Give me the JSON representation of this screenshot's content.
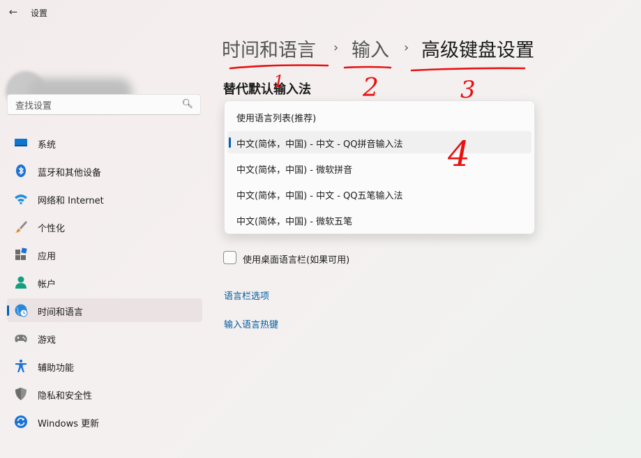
{
  "app": {
    "title": "设置"
  },
  "search": {
    "placeholder": "查找设置"
  },
  "sidebar": {
    "items": [
      {
        "label": "系统",
        "icon": "system-icon"
      },
      {
        "label": "蓝牙和其他设备",
        "icon": "bluetooth-icon"
      },
      {
        "label": "网络和 Internet",
        "icon": "wifi-icon"
      },
      {
        "label": "个性化",
        "icon": "brush-icon"
      },
      {
        "label": "应用",
        "icon": "apps-icon"
      },
      {
        "label": "帐户",
        "icon": "account-icon"
      },
      {
        "label": "时间和语言",
        "icon": "globe-clock-icon",
        "selected": true
      },
      {
        "label": "游戏",
        "icon": "gamepad-icon"
      },
      {
        "label": "辅助功能",
        "icon": "accessibility-icon"
      },
      {
        "label": "隐私和安全性",
        "icon": "shield-icon"
      },
      {
        "label": "Windows 更新",
        "icon": "update-icon"
      }
    ]
  },
  "breadcrumb": {
    "items": [
      "时间和语言",
      "输入",
      "高级键盘设置"
    ],
    "separator": "›"
  },
  "main": {
    "section_title": "替代默认输入法",
    "dropdown_options": [
      "使用语言列表(推荐)",
      "中文(简体，中国) - 中文 - QQ拼音输入法",
      "中文(简体，中国) - 微软拼音",
      "中文(简体，中国) - 中文 - QQ五笔输入法",
      "中文(简体，中国) - 微软五笔"
    ],
    "selected_option_index": 1,
    "checkbox_label": "使用桌面语言栏(如果可用)",
    "checkbox_checked": false,
    "links": [
      "语言栏选项",
      "输入语言热键"
    ]
  },
  "annotations": {
    "numbers": [
      "1",
      "2",
      "3",
      "4"
    ],
    "color": "#e81010"
  },
  "colors": {
    "accent": "#005fb8",
    "link": "#005a9e"
  }
}
